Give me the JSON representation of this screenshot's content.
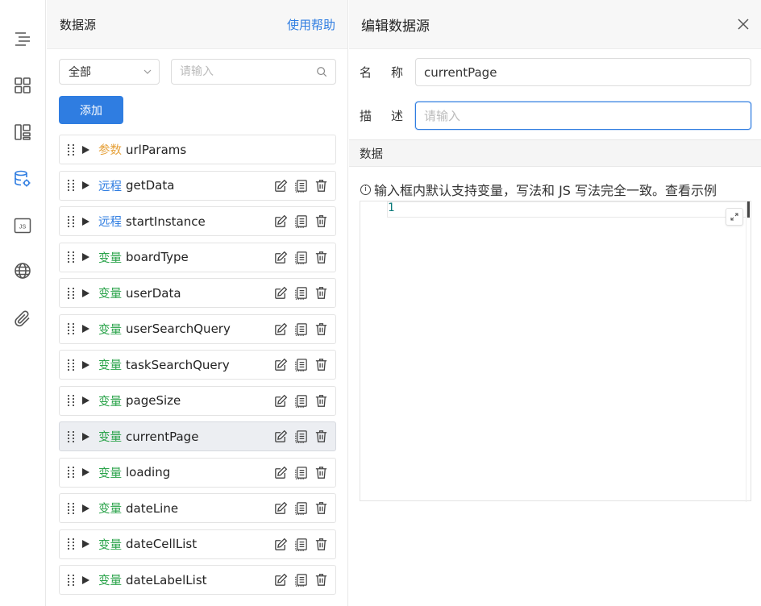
{
  "rail": {
    "icons": [
      "outline-icon",
      "components-icon",
      "layout-icon",
      "datasource-icon",
      "js-icon",
      "globe-icon",
      "attachment-icon"
    ],
    "js_label": "JS"
  },
  "list": {
    "title": "数据源",
    "help": "使用帮助",
    "filter_value": "全部",
    "search_placeholder": "请输入",
    "add_label": "添加",
    "items": [
      {
        "tag": "参数",
        "kind": "param",
        "name": "urlParams",
        "selected": false,
        "actions": false
      },
      {
        "tag": "远程",
        "kind": "remote",
        "name": "getData",
        "selected": false,
        "actions": true
      },
      {
        "tag": "远程",
        "kind": "remote",
        "name": "startInstance",
        "selected": false,
        "actions": true
      },
      {
        "tag": "变量",
        "kind": "var",
        "name": "boardType",
        "selected": false,
        "actions": true
      },
      {
        "tag": "变量",
        "kind": "var",
        "name": "userData",
        "selected": false,
        "actions": true
      },
      {
        "tag": "变量",
        "kind": "var",
        "name": "userSearchQuery",
        "selected": false,
        "actions": true
      },
      {
        "tag": "变量",
        "kind": "var",
        "name": "taskSearchQuery",
        "selected": false,
        "actions": true
      },
      {
        "tag": "变量",
        "kind": "var",
        "name": "pageSize",
        "selected": false,
        "actions": true
      },
      {
        "tag": "变量",
        "kind": "var",
        "name": "currentPage",
        "selected": true,
        "actions": true
      },
      {
        "tag": "变量",
        "kind": "var",
        "name": "loading",
        "selected": false,
        "actions": true
      },
      {
        "tag": "变量",
        "kind": "var",
        "name": "dateLine",
        "selected": false,
        "actions": true
      },
      {
        "tag": "变量",
        "kind": "var",
        "name": "dateCellList",
        "selected": false,
        "actions": true
      },
      {
        "tag": "变量",
        "kind": "var",
        "name": "dateLabelList",
        "selected": false,
        "actions": true
      }
    ]
  },
  "edit": {
    "title": "编辑数据源",
    "name_label": "名称",
    "name_value": "currentPage",
    "desc_label": "描述",
    "desc_placeholder": "请输入",
    "section": "数据",
    "hint": "输入框内默认支持变量，写法和 JS 写法完全一致。查看示例",
    "line_number": "1"
  },
  "colors": {
    "accent": "#2f7de1",
    "param": "#e6a23c",
    "var": "#2aa34a"
  }
}
